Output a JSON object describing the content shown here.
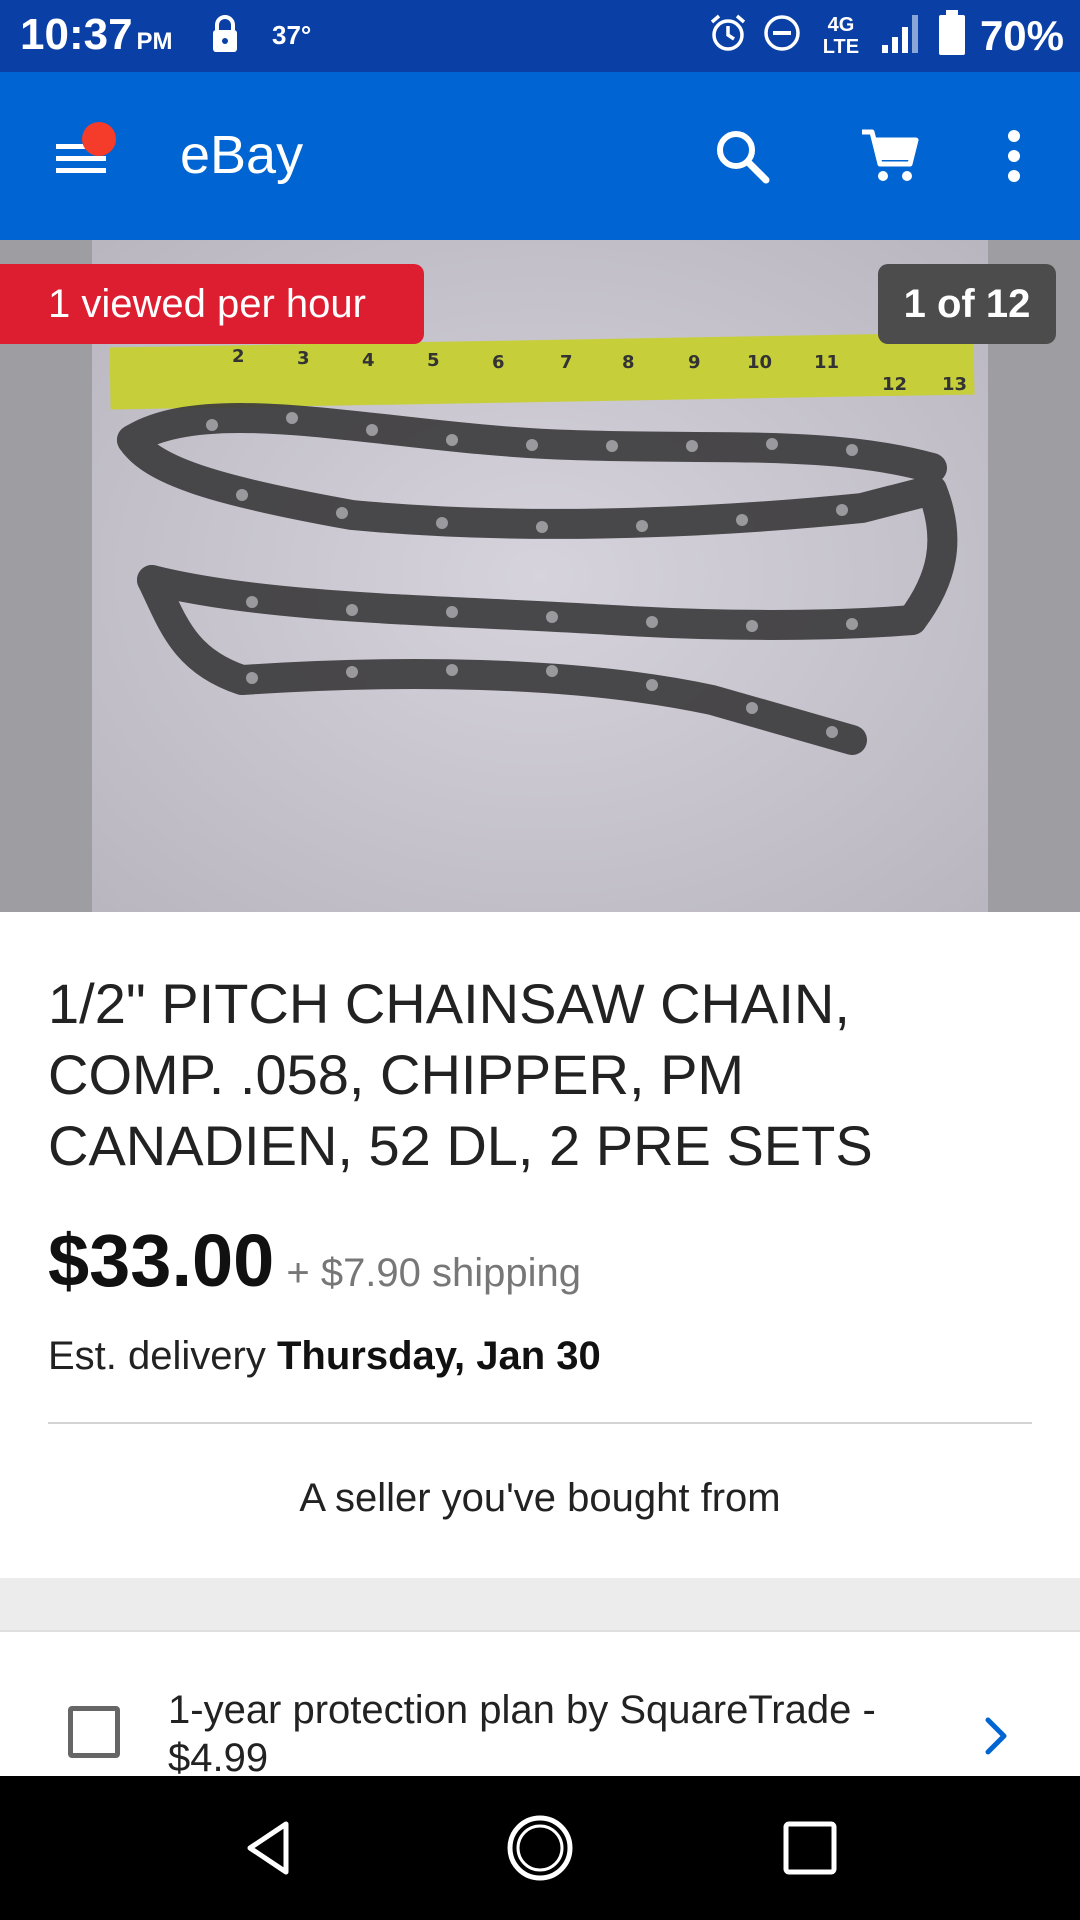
{
  "status_bar": {
    "time": "10:37",
    "ampm": "PM",
    "temperature": "37°",
    "network": "4G LTE",
    "battery": "70%",
    "icons": [
      "lock-icon",
      "alarm-icon",
      "do-not-disturb-icon",
      "lte-icon",
      "signal-icon",
      "battery-icon"
    ]
  },
  "app_bar": {
    "title": "eBay",
    "icons": [
      "menu-icon",
      "search-icon",
      "cart-icon",
      "more-vert-icon"
    ],
    "notification_dot_color": "#f53c2a"
  },
  "gallery": {
    "viewed_badge": "1 viewed per hour",
    "counter": "1 of 12"
  },
  "listing": {
    "title": "1/2\" PITCH CHAINSAW CHAIN, COMP. .058, CHIPPER, PM CANADIEN,  52 DL, 2 PRE SETS",
    "price": "$33.00",
    "shipping": "+ $7.90 shipping",
    "delivery_prefix": "Est. delivery ",
    "delivery_date": "Thursday, Jan 30",
    "seller_note": "A seller you've bought from"
  },
  "protection": {
    "label": "1-year protection plan by SquareTrade - $4.99",
    "checked": false
  },
  "nav_bar": {
    "icons": [
      "back-icon",
      "home-icon",
      "recents-icon"
    ]
  },
  "colors": {
    "status_bar": "#0a3fa6",
    "app_bar": "#0064d2",
    "viewed_badge": "#dd1e31",
    "chevron": "#0064d2"
  }
}
